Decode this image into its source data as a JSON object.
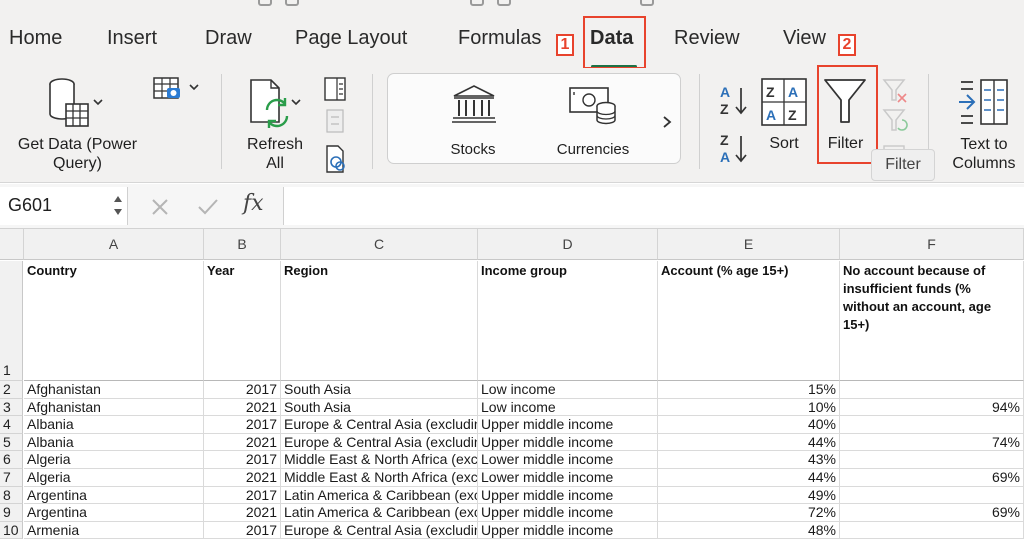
{
  "tabs": [
    {
      "label": "Home"
    },
    {
      "label": "Insert"
    },
    {
      "label": "Draw"
    },
    {
      "label": "Page Layout"
    },
    {
      "label": "Formulas"
    },
    {
      "label": "Data"
    },
    {
      "label": "Review"
    },
    {
      "label": "View"
    }
  ],
  "steps": {
    "one": "1",
    "two": "2"
  },
  "ribbon": {
    "get_data_line1": "Get Data (Power",
    "get_data_line2": "Query)",
    "refresh_line1": "Refresh",
    "refresh_line2": "All",
    "stocks": "Stocks",
    "currencies": "Currencies",
    "sort": "Sort",
    "filter": "Filter",
    "text_to_columns_line1": "Text to",
    "text_to_columns_line2": "Columns",
    "tooltip": "Filter"
  },
  "formula_bar": {
    "cell_ref": "G601",
    "fx": "fx",
    "value": ""
  },
  "grid": {
    "columns": [
      "A",
      "B",
      "C",
      "D",
      "E",
      "F"
    ],
    "headers": [
      "Country",
      "Year",
      "Region",
      "Income group",
      "Account (% age 15+)",
      "No account because of insufficient funds (% without an account, age 15+)"
    ],
    "header_row_number": "1",
    "rows": [
      {
        "n": "2",
        "country": "Afghanistan",
        "year": "2017",
        "region": "South Asia",
        "income": "Low income",
        "account": "15%",
        "noacct": ""
      },
      {
        "n": "3",
        "country": "Afghanistan",
        "year": "2021",
        "region": "South Asia",
        "income": "Low income",
        "account": "10%",
        "noacct": "94%"
      },
      {
        "n": "4",
        "country": "Albania",
        "year": "2017",
        "region": "Europe & Central Asia (excluding high income)",
        "income": "Upper middle income",
        "account": "40%",
        "noacct": ""
      },
      {
        "n": "5",
        "country": "Albania",
        "year": "2021",
        "region": "Europe & Central Asia (excluding high income)",
        "income": "Upper middle income",
        "account": "44%",
        "noacct": "74%"
      },
      {
        "n": "6",
        "country": "Algeria",
        "year": "2017",
        "region": "Middle East & North Africa (excluding high income)",
        "income": "Lower middle income",
        "account": "43%",
        "noacct": ""
      },
      {
        "n": "7",
        "country": "Algeria",
        "year": "2021",
        "region": "Middle East & North Africa (excluding high income)",
        "income": "Lower middle income",
        "account": "44%",
        "noacct": "69%"
      },
      {
        "n": "8",
        "country": "Argentina",
        "year": "2017",
        "region": "Latin America & Caribbean (excluding high income)",
        "income": "Upper middle income",
        "account": "49%",
        "noacct": ""
      },
      {
        "n": "9",
        "country": "Argentina",
        "year": "2021",
        "region": "Latin America & Caribbean (excluding high income)",
        "income": "Upper middle income",
        "account": "72%",
        "noacct": "69%"
      },
      {
        "n": "10",
        "country": "Armenia",
        "year": "2017",
        "region": "Europe & Central Asia (excluding high income)",
        "income": "Upper middle income",
        "account": "48%",
        "noacct": ""
      }
    ]
  },
  "colors": {
    "accent_green": "#1e7145",
    "annotation_red": "#e8432d"
  }
}
